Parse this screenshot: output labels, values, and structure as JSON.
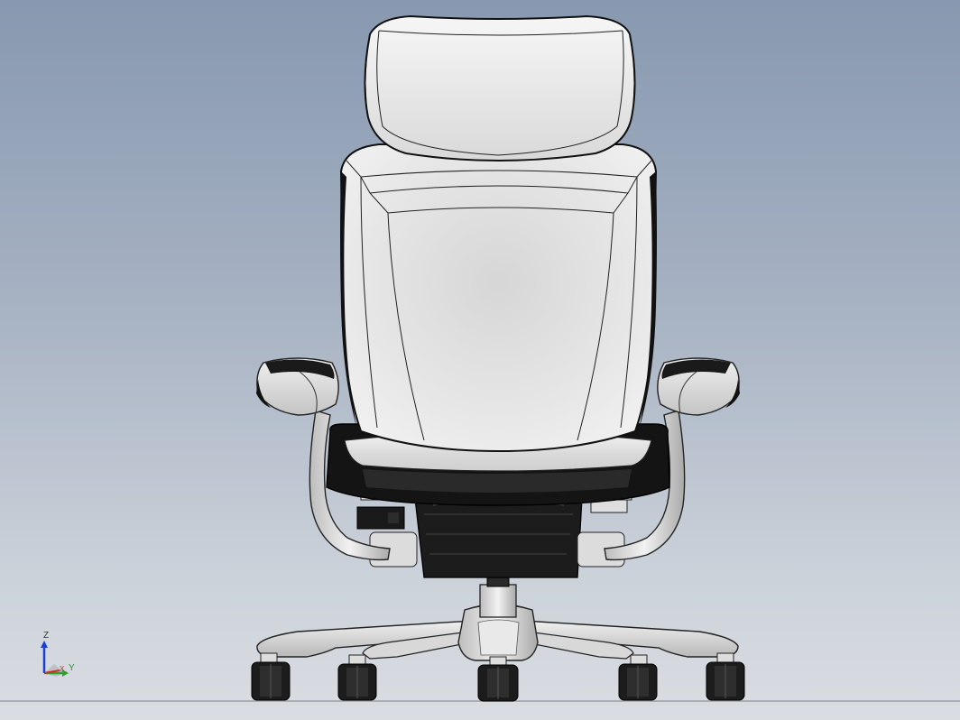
{
  "viewport": {
    "background_top": "#8798b0",
    "background_bottom": "#dadde2"
  },
  "model": {
    "shading_light": "#f2f2f2",
    "shading_mid": "#c8c8c8",
    "edge_color": "#111111",
    "mechanism_color": "#1a1a1a"
  },
  "triad": {
    "z_label": "Z",
    "x_label": "X",
    "y_label": "Y",
    "z_color": "#1a3fd6",
    "x_color": "#d02a2a",
    "y_color": "#2f9f2f"
  }
}
